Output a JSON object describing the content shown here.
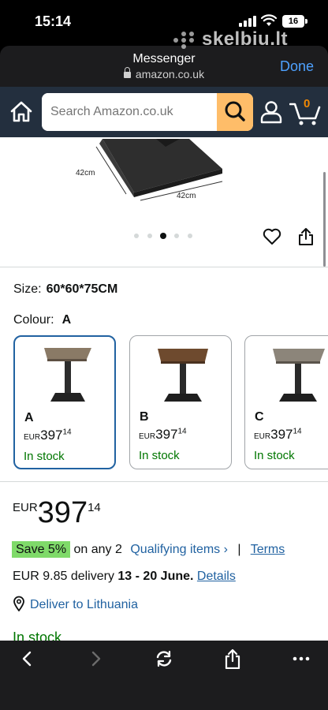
{
  "status_bar": {
    "time": "15:14",
    "battery": "16"
  },
  "watermark": {
    "text": "skelbiu.lt"
  },
  "browser": {
    "title": "Messenger",
    "url": "amazon.co.uk",
    "done_label": "Done"
  },
  "amazon_header": {
    "search_placeholder": "Search Amazon.co.uk",
    "cart_count": "0"
  },
  "product_image": {
    "dim_left": "42cm",
    "dim_right": "42cm"
  },
  "options": {
    "size_label": "Size:",
    "size_value": "60*60*75CM",
    "colour_label": "Colour:",
    "colour_value": "A"
  },
  "swatches": [
    {
      "label": "A",
      "currency": "EUR",
      "whole": "397",
      "fraction": "14",
      "stock": "In stock"
    },
    {
      "label": "B",
      "currency": "EUR",
      "whole": "397",
      "fraction": "14",
      "stock": "In stock"
    },
    {
      "label": "C",
      "currency": "EUR",
      "whole": "397",
      "fraction": "14",
      "stock": "In stock"
    }
  ],
  "price": {
    "currency": "EUR",
    "whole": "397",
    "fraction": "14"
  },
  "promo": {
    "badge": "Save 5%",
    "text": "on any 2",
    "qualifying": "Qualifying items ›",
    "separator": "|",
    "terms": "Terms"
  },
  "delivery": {
    "prefix": "EUR 9.85 delivery",
    "dates": "13 - 20 June.",
    "details": "Details",
    "deliver_to": "Deliver to Lithuania"
  },
  "stock_status": "In stock",
  "colors": {
    "amazon_nav": "#232f3e",
    "search_button": "#febd69",
    "link": "#2162a1",
    "in_stock": "#007600",
    "save_badge": "#7fda69"
  }
}
